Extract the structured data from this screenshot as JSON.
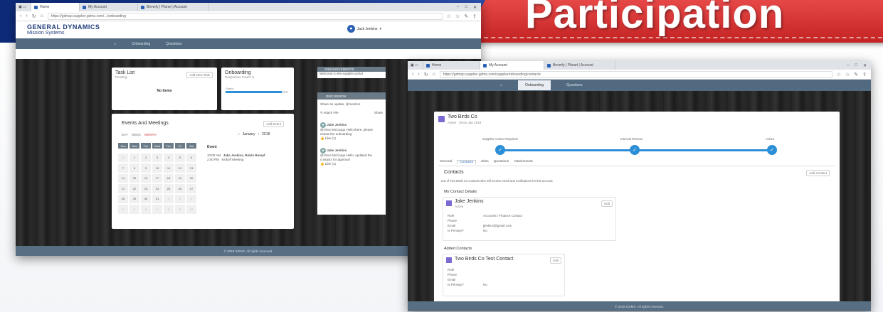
{
  "banner": {
    "title": "Participation"
  },
  "win1": {
    "tabs": [
      "Home",
      "My Account",
      "Beverly | Planet | Account"
    ],
    "url": "https://gdmsp.supplier.gdms.com/.../onboarding",
    "brand_line1": "GENERAL DYNAMICS",
    "brand_line2": "Mission Systems",
    "user": "Jack Jenkins",
    "nav": [
      "Onboarding",
      "Questions"
    ],
    "task_list": {
      "title": "Task List",
      "sub": "Pending",
      "empty": "No Items",
      "button": "Add New Task"
    },
    "onboarding": {
      "title": "Onboarding",
      "sub": "Responses Count: 8",
      "bar_label": "Status",
      "progress": 0.9
    },
    "events": {
      "title": "Events And Meetings",
      "button": "Add Event",
      "views": [
        "DAY",
        "WEEK",
        "MONTH"
      ],
      "month": "January",
      "year": "2018",
      "weekdays": [
        "Sun",
        "Mon",
        "Tue",
        "Wed",
        "Thu",
        "Fri",
        "Sat"
      ],
      "weeks": [
        [
          "31",
          "1",
          "2",
          "3",
          "4",
          "5",
          "6"
        ],
        [
          "7",
          "8",
          "9",
          "10",
          "11",
          "12",
          "13"
        ],
        [
          "14",
          "15",
          "16",
          "17",
          "18",
          "19",
          "20"
        ],
        [
          "21",
          "22",
          "23",
          "24",
          "25",
          "26",
          "27"
        ],
        [
          "28",
          "29",
          "30",
          "31",
          "1",
          "2",
          "3"
        ],
        [
          "4",
          "5",
          "6",
          "7",
          "8",
          "9",
          "10"
        ]
      ],
      "event_header": "Event",
      "event_rows": [
        {
          "time": "10:00 AM",
          "text": "Jake Jenkins, Robin Rumpf"
        },
        {
          "time": "2:00 PM",
          "text": "Kickoff Meeting"
        }
      ]
    },
    "announcements": {
      "title": "ANNOUNCEMENTS",
      "text": "Welcome to the supplier portal"
    },
    "discussion": {
      "title": "DISCUSSION",
      "prompt": "Share an update, @mention",
      "attach": "Attach File",
      "share": "Share",
      "posts": [
        {
          "name": "Jake Jenkins",
          "text": "@Vince McCargo Hello there, please review the onboarding",
          "likes": "Like (1)"
        },
        {
          "name": "Jake Jenkins",
          "text": "@Vince McCargo Hello, updated the contacts for approval",
          "likes": "Like (1)"
        }
      ]
    },
    "footer": "© 2018 GDMS. All rights reserved."
  },
  "win2": {
    "tabs": [
      "Home",
      "My Account",
      "Beverly | Planet | Account"
    ],
    "url": "https://gdmsp.supplier.gdms.com/supplieronboarding/contacts",
    "nav": [
      "Onboarding",
      "Questions"
    ],
    "company": {
      "name": "Two Birds Co",
      "sub": "Active · Since Jan 2018"
    },
    "steps": [
      "Supplier Action Required",
      "Internal Review",
      "Active"
    ],
    "inner_tabs": [
      "General",
      "Contacts",
      "Sites",
      "Questions",
      "Attachments"
    ],
    "contacts": {
      "title": "Contacts",
      "button": "Add Contact",
      "desc": "List of Two Birds Co contacts who will receive email and notifications for this account.",
      "my_title": "My Contact Details",
      "added_title": "Added Contacts"
    },
    "contact1": {
      "name": "Jake Jenkins",
      "status": "Active",
      "edit": "Edit",
      "fields": [
        {
          "k": "Role",
          "v": "Accounts / Finance Contact"
        },
        {
          "k": "Phone",
          "v": ""
        },
        {
          "k": "Email",
          "v": "jjenkins@gmail.com"
        },
        {
          "k": "Is Primary?",
          "v": "No"
        }
      ]
    },
    "contact2": {
      "name": "Two Birds Co Test Contact",
      "edit": "Edit",
      "fields": [
        {
          "k": "Role",
          "v": ""
        },
        {
          "k": "Phone",
          "v": ""
        },
        {
          "k": "Email",
          "v": ""
        },
        {
          "k": "Is Primary?",
          "v": "No"
        }
      ]
    },
    "footer": "© 2018 GDMS. All rights reserved."
  }
}
